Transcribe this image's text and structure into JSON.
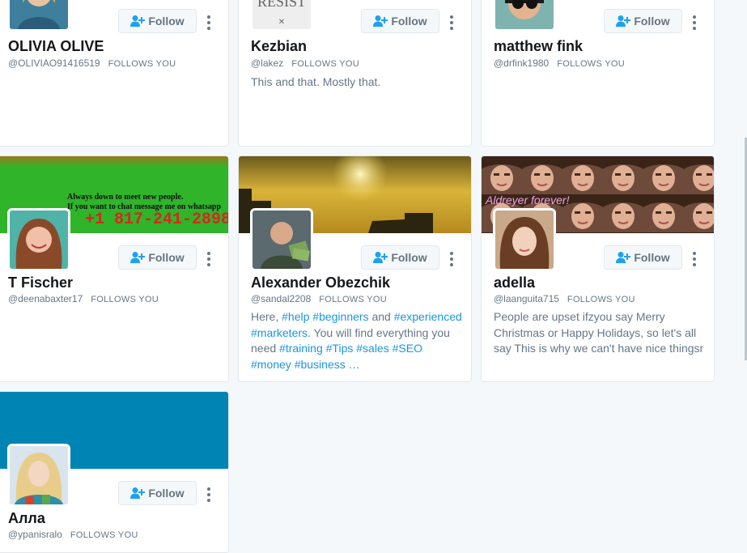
{
  "follow_label": "Follow",
  "follows_you": "FOLLOWS YOU",
  "colors": {
    "accent": "#1da1f2",
    "link": "#1b95e0",
    "text_muted": "#657786",
    "card_border": "#e1e8ed"
  },
  "cards": [
    {
      "name": "OLIVIA OLIVE",
      "handle": "@OLIVIAO91416519",
      "bio": ""
    },
    {
      "name": "Kezbian",
      "handle": "@lakez",
      "bio": "This and that. Mostly that.",
      "avatar_text": "RESIST"
    },
    {
      "name": "matthew fink",
      "handle": "@drfink1980",
      "bio": ""
    },
    {
      "name": "T Fischer",
      "handle": "@deenabaxter17",
      "bio": "",
      "banner_line1": "Always down to meet new people.",
      "banner_line2": "If you want to chat message me on whatsapp",
      "banner_phone": "+1 817-241-2898"
    },
    {
      "name": "Alexander Obezchik",
      "handle": "@sandal2208",
      "bio_parts": {
        "p1": "Here, ",
        "p2": "#help",
        "p3": " ",
        "p4": "#beginners",
        "p5": " and ",
        "p6": "#experienced",
        "p7": " ",
        "p8": "#marketers",
        "p9": ". You will find everything you need ",
        "p10": "#training",
        "p11": " ",
        "p12": "#Tips",
        "p13": " ",
        "p14": "#sales",
        "p15": " ",
        "p16": "#SEO",
        "p17": " ",
        "p18": "#money",
        "p19": " ",
        "p20": "#business",
        "p21": " …"
      }
    },
    {
      "name": "adella",
      "handle": "@laanguita715",
      "bio": "People are upset ifzyou say Merry Christmas or Happy Holidays, so let's all say This is why we can't have nice thingsr",
      "banner_text": "Aldreyer forever!"
    },
    {
      "name": "Алла",
      "handle": "@ypanisralo",
      "bio": ""
    }
  ]
}
